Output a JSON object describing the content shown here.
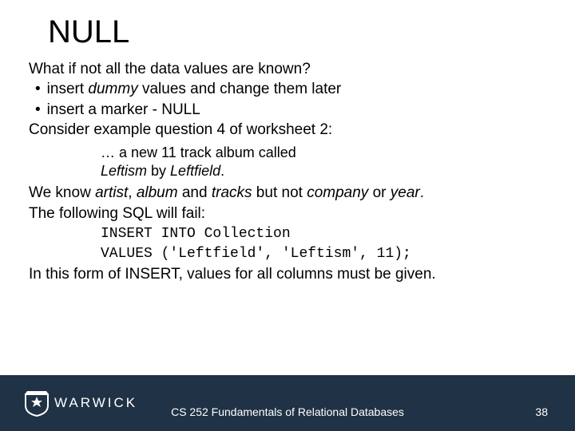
{
  "slide": {
    "title": "NULL",
    "line1": "What if not all the data values are known?",
    "bullet1_pre": "insert ",
    "bullet1_em": "dummy",
    "bullet1_post": " values and change them later",
    "bullet2": "insert a marker - NULL",
    "line3": "Consider example question 4 of worksheet 2:",
    "sub1": "… a new 11 track album called",
    "sub2_em": "Leftism",
    "sub2_mid": " by ",
    "sub2_em2": "Leftfield",
    "sub2_end": ".",
    "line4_pre": "We know ",
    "line4_a": "artist",
    "line4_s1": ", ",
    "line4_b": "album",
    "line4_s2": " and ",
    "line4_c": "tracks",
    "line4_s3": " but not ",
    "line4_d": "company",
    "line4_s4": " or ",
    "line4_e": "year",
    "line4_end": ".",
    "line5": "The following SQL will fail:",
    "code1": "INSERT INTO Collection",
    "code2": "VALUES ('Leftfield', 'Leftism', 11);",
    "line6": "In this form of INSERT, values for all columns must be given."
  },
  "footer": {
    "logo_text": "WARWICK",
    "course": "CS 252 Fundamentals of Relational Databases",
    "page": "38"
  }
}
